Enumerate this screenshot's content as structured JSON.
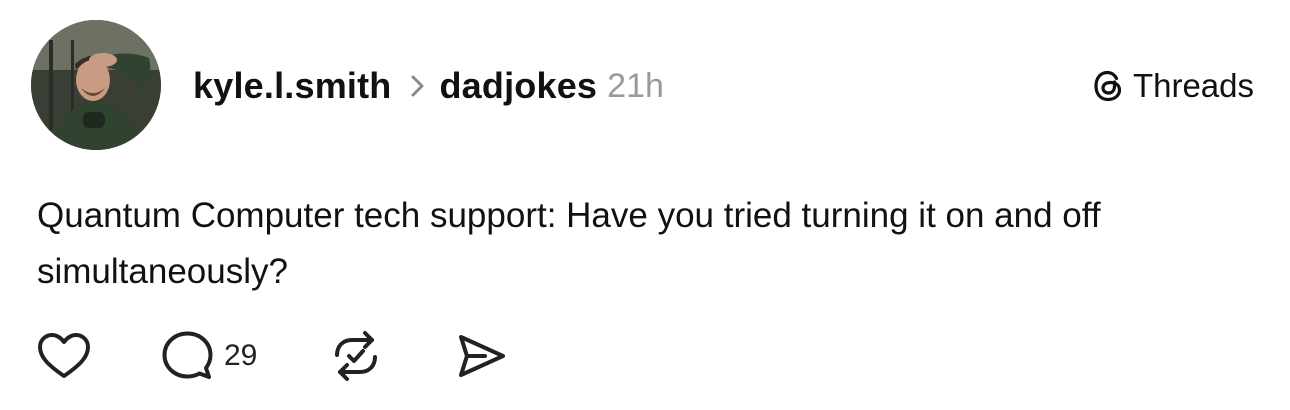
{
  "post": {
    "author": "kyle.l.smith",
    "community": "dadjokes",
    "time": "21h",
    "text": "Quantum Computer tech support: Have you tried turning it on and off simultaneously?"
  },
  "brand": {
    "name": "Threads",
    "icon": "threads-logo-icon"
  },
  "actions": {
    "like": {
      "icon": "heart-icon"
    },
    "reply": {
      "icon": "speech-bubble-icon",
      "count": "29"
    },
    "repost": {
      "icon": "repost-icon"
    },
    "share": {
      "icon": "send-icon"
    }
  },
  "colors": {
    "text": "#111111",
    "muted": "#9a9a9a",
    "background": "#ffffff"
  }
}
